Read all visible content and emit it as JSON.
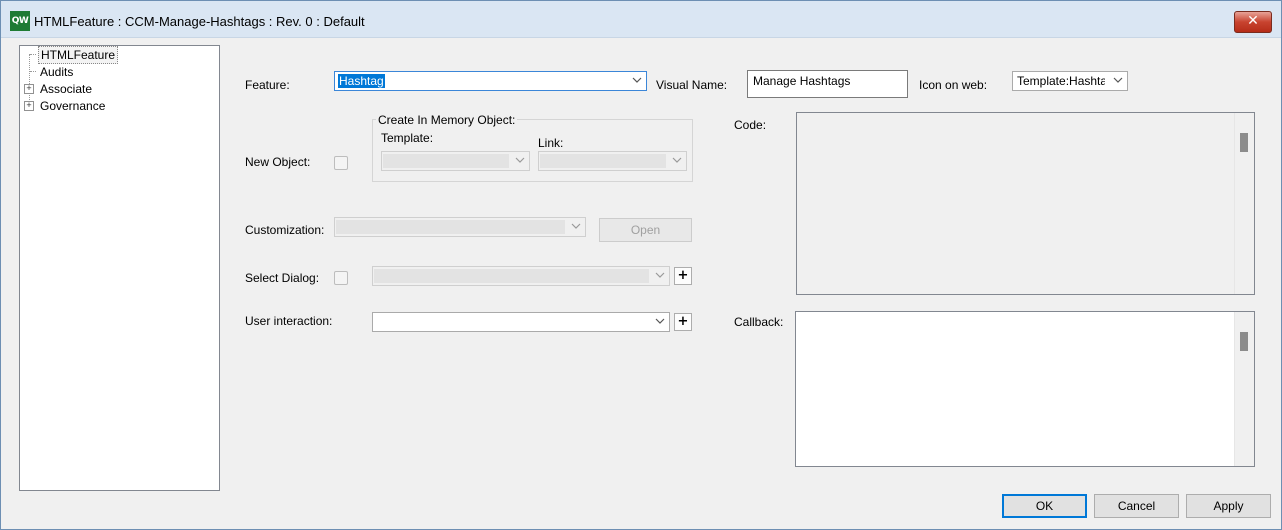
{
  "window": {
    "title": "HTMLFeature : CCM-Manage-Hashtags : Rev. 0  : Default",
    "app_icon_text": "QW",
    "close_glyph": "✕"
  },
  "tree": {
    "items": [
      {
        "label": "HTMLFeature",
        "selected": true,
        "expandable": false
      },
      {
        "label": "Audits",
        "selected": false,
        "expandable": false
      },
      {
        "label": "Associate",
        "selected": false,
        "expandable": true
      },
      {
        "label": "Governance",
        "selected": false,
        "expandable": true
      }
    ]
  },
  "form": {
    "feature_label": "Feature:",
    "feature_value": "Hashtag",
    "visual_name_label": "Visual Name:",
    "visual_name_value": "Manage Hashtags",
    "icon_on_web_label": "Icon on web:",
    "icon_on_web_value": "Template:Hashta",
    "new_object_label": "New Object:",
    "create_in_memory_label": "Create In Memory Object:",
    "template_label": "Template:",
    "link_label": "Link:",
    "customization_label": "Customization:",
    "open_button": "Open",
    "select_dialog_label": "Select Dialog:",
    "user_interaction_label": "User interaction:",
    "plus_glyph": "+",
    "code_label": "Code:",
    "callback_label": "Callback:"
  },
  "buttons": {
    "ok": "OK",
    "cancel": "Cancel",
    "apply": "Apply"
  },
  "colors": {
    "selection_highlight": "#0078d7",
    "app_icon": "#1e7b34",
    "close_button": "#c8432f"
  }
}
